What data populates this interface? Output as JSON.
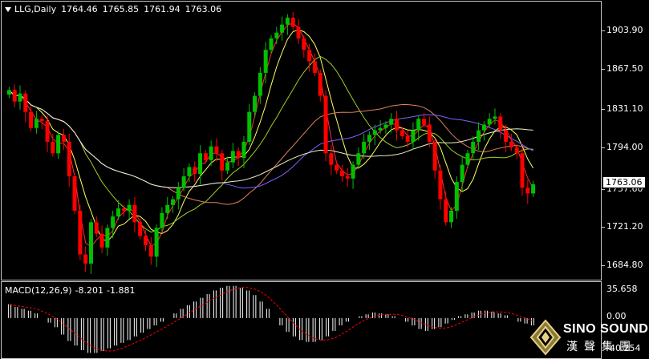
{
  "header": {
    "symbol": "LLG,Daily",
    "open": "1764.46",
    "high": "1765.85",
    "low": "1761.94",
    "close": "1763.06"
  },
  "price_axis": {
    "labels": [
      "1903.90",
      "1867.50",
      "1831.10",
      "1794.00",
      "1757.60",
      "1721.20",
      "1684.80"
    ],
    "current_price": "1763.06"
  },
  "macd": {
    "label": "MACD(12,26,9)",
    "main": "-8.201",
    "signal": "-1.881",
    "axis_labels": [
      "35.658",
      "0.00",
      "-40.254"
    ]
  },
  "logo": {
    "brand": "SINO SOUND",
    "brand_cn": "漢聲集團"
  },
  "colors": {
    "background": "#000000",
    "bull_candle": "#00c000",
    "bear_candle": "#ff0000",
    "ma_fast": "#ff3030",
    "ma_yellow": "#ffff60",
    "ma_green": "#a0d020",
    "ma_orange": "#e08060",
    "ma_purple": "#8060ff",
    "ma_white": "#f0f0c0",
    "macd_hist": "#ffffff",
    "macd_signal": "#ff0000"
  },
  "chart_data": {
    "type": "candlestick",
    "ylim": [
      1680,
      1922
    ],
    "close_path": [
      1845,
      1835,
      1842,
      1826,
      1812,
      1820,
      1818,
      1800,
      1790,
      1806,
      1800,
      1770,
      1740,
      1702,
      1694,
      1730,
      1720,
      1708,
      1725,
      1735,
      1742,
      1740,
      1745,
      1730,
      1718,
      1710,
      1700,
      1725,
      1738,
      1745,
      1750,
      1760,
      1770,
      1778,
      1772,
      1790,
      1784,
      1796,
      1790,
      1775,
      1782,
      1792,
      1786,
      1800,
      1826,
      1840,
      1860,
      1880,
      1890,
      1895,
      1902,
      1908,
      1900,
      1890,
      1880,
      1870,
      1860,
      1840,
      1790,
      1780,
      1775,
      1770,
      1768,
      1780,
      1790,
      1800,
      1806,
      1810,
      1812,
      1815,
      1820,
      1810,
      1805,
      1800,
      1810,
      1820,
      1815,
      1800,
      1775,
      1750,
      1730,
      1740,
      1765,
      1780,
      1790,
      1800,
      1810,
      1815,
      1820,
      1822,
      1810,
      1800,
      1795,
      1790,
      1760,
      1755,
      1763
    ],
    "macd_hist": [
      15,
      12,
      10,
      8,
      5,
      0,
      -5,
      -10,
      -18,
      -25,
      -30,
      -35,
      -38,
      -38,
      -36,
      -33,
      -30,
      -27,
      -24,
      -20,
      -16,
      -12,
      -8,
      -4,
      0,
      5,
      10,
      14,
      18,
      22,
      26,
      30,
      33,
      35,
      35,
      33,
      30,
      25,
      18,
      10,
      0,
      -8,
      -15,
      -20,
      -24,
      -26,
      -26,
      -24,
      -20,
      -14,
      -8,
      -4,
      0,
      2,
      4,
      6,
      5,
      4,
      2,
      0,
      -4,
      -8,
      -12,
      -14,
      -12,
      -10,
      -6,
      -2,
      2,
      4,
      6,
      8,
      8,
      7,
      5,
      3,
      0,
      -4,
      -6,
      -8
    ]
  }
}
